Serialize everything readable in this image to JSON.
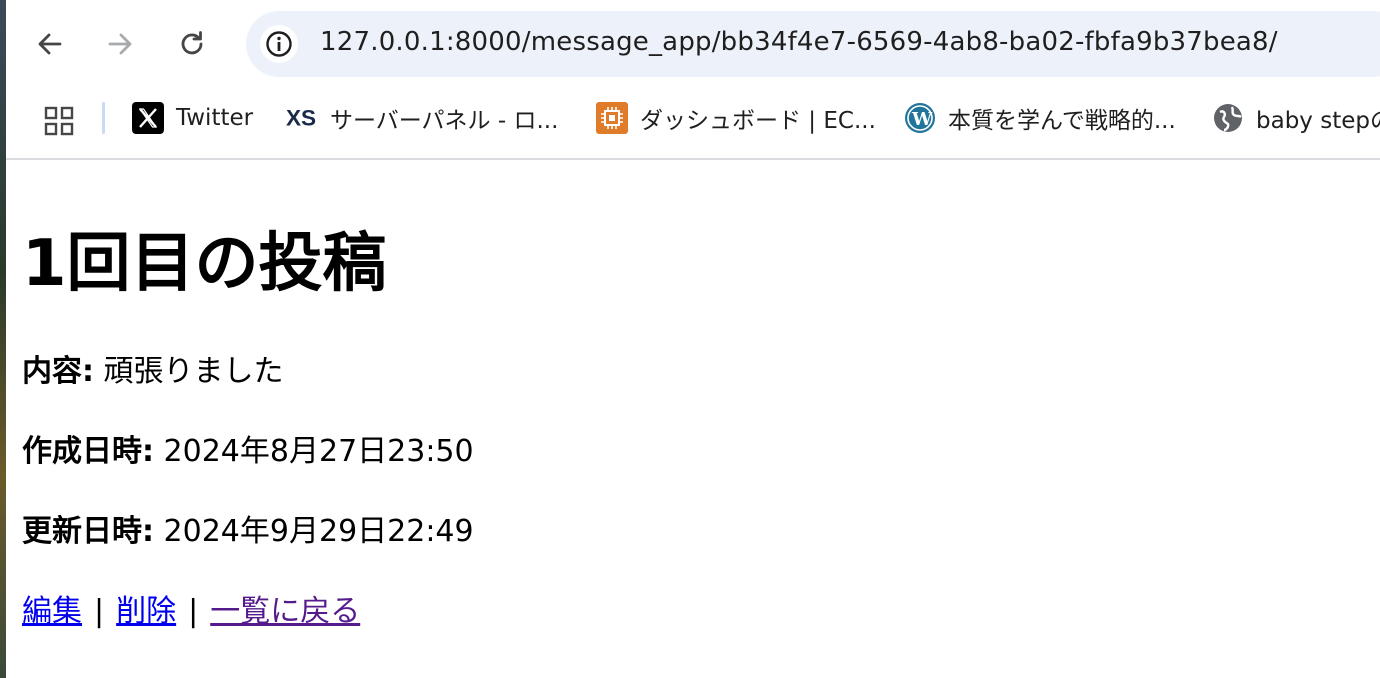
{
  "browser": {
    "url": "127.0.0.1:8000/message_app/bb34f4e7-6569-4ab8-ba02-fbfa9b37bea8/",
    "bookmarks": [
      {
        "label": "Twitter",
        "icon": "x-logo-icon"
      },
      {
        "label": "サーバーパネル - ロ...",
        "icon": "xs-logo-icon"
      },
      {
        "label": "ダッシュボード | EC...",
        "icon": "aws-ec2-icon"
      },
      {
        "label": "本質を学んで戦略的...",
        "icon": "wordpress-icon"
      },
      {
        "label": "baby stepの",
        "icon": "globe-icon"
      }
    ]
  },
  "page": {
    "title": "1回目の投稿",
    "content_label": "内容:",
    "content_value": "頑張りました",
    "created_label": "作成日時:",
    "created_value": "2024年8月27日23:50",
    "updated_label": "更新日時:",
    "updated_value": "2024年9月29日22:49",
    "links": {
      "edit": "編集",
      "delete": "削除",
      "back": "一覧に戻る",
      "separator": "|"
    }
  },
  "colors": {
    "link": "#0000ee",
    "visited_link": "#551a8b",
    "omnibox_bg": "#edf2fa"
  }
}
